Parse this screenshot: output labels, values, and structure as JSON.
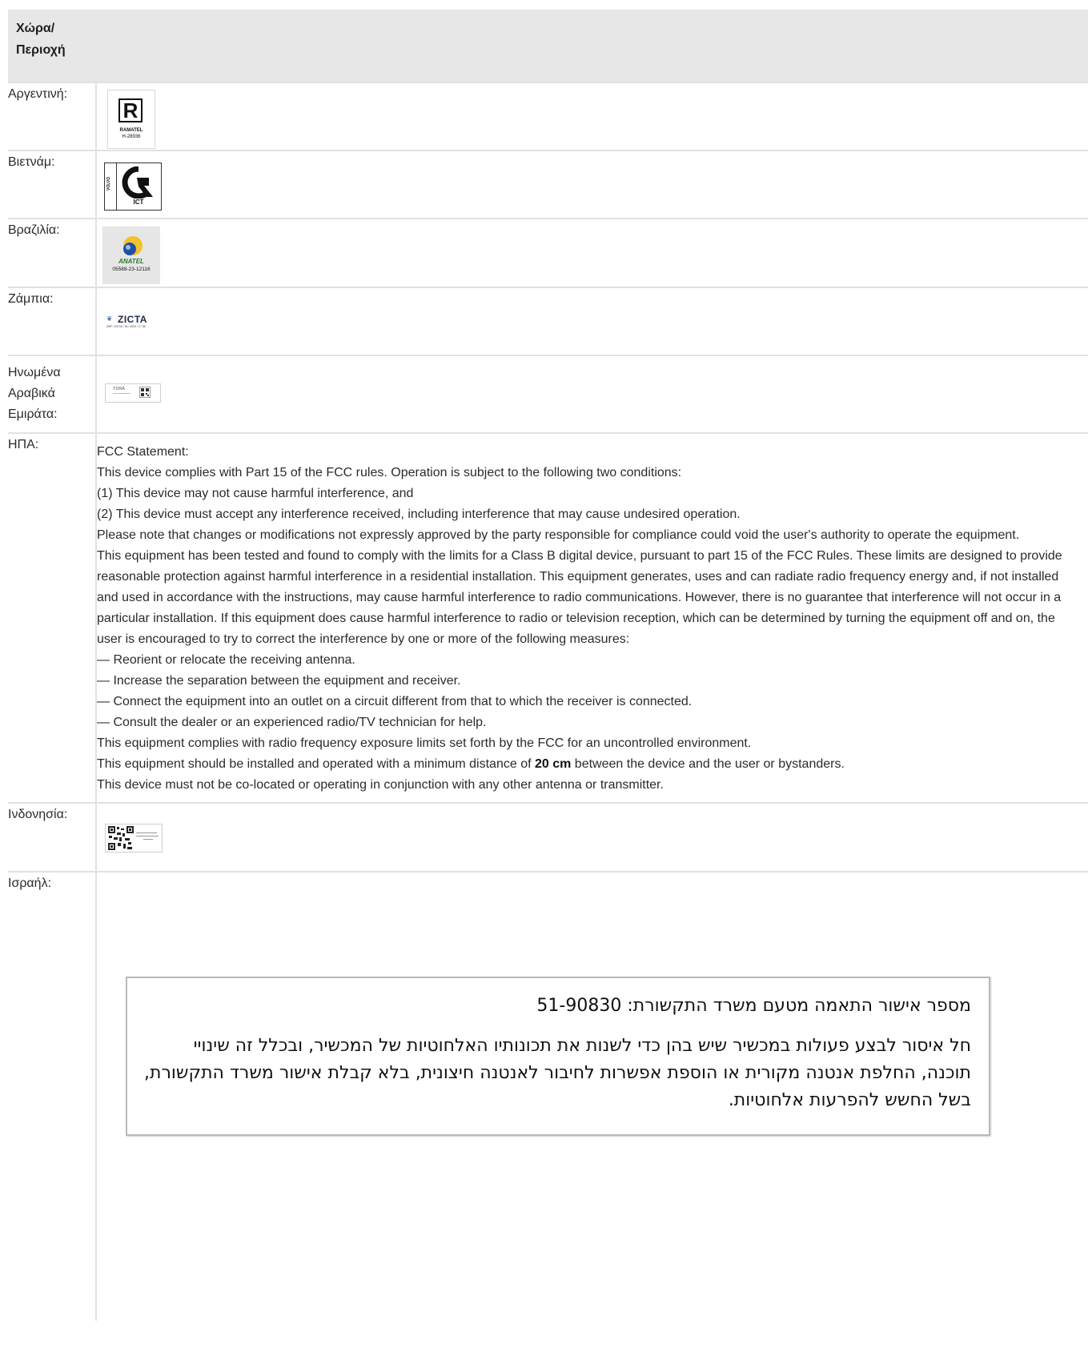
{
  "header": {
    "country_col": "Χώρα/\nΠεριοχή",
    "content_col": ""
  },
  "rows": {
    "argentina": {
      "country": "Αργεντινή:",
      "logo_icon": "ramatel-logo",
      "logo_text": [
        "RAMATEL",
        "H-28936"
      ]
    },
    "vietnam": {
      "country": "Βιετνάμ:",
      "logo_icon": "ict-logo",
      "logo_text": [
        "VOLVO",
        "ICT"
      ]
    },
    "brazil": {
      "country": "Βραζιλία:",
      "logo_icon": "anatel-logo",
      "logo_text": [
        "ANATEL",
        "05588-23-12116"
      ]
    },
    "zambia": {
      "country": "Ζάμπια:",
      "logo_icon": "zicta-logo",
      "logo_text": [
        "ZICTA",
        "ZNF / ZICTA / TA / 2023 / 2 / 36"
      ]
    },
    "uae": {
      "country": "Ηνωμένα\nΑραβικά\nΕμιράτα:",
      "logo_icon": "tdra-logo",
      "logo_text": [
        "TDRA"
      ]
    },
    "usa": {
      "country": "ΗΠΑ:",
      "fcc_lines": [
        "FCC Statement:",
        "This device complies with Part 15 of the FCC rules. Operation is subject to the following two conditions:",
        "(1) This device may not cause harmful interference, and",
        "(2) This device must accept any interference received, including interference that may cause undesired operation.",
        "Please note that changes or modifications not expressly approved by the party responsible for compliance could void the user's authority to operate the equipment.",
        "This equipment has been tested and found to comply with the limits for a Class B digital device, pursuant to part 15 of the FCC Rules. These limits are designed to provide reasonable protection against harmful interference in a residential installation. This equipment generates, uses and can radiate radio frequency energy and, if not installed and used in accordance with the instructions, may cause harmful interference to radio communications. However, there is no guarantee that interference will not occur in a particular installation. If this equipment does cause harmful interference to radio or television reception, which can be determined by turning the equipment off and on, the user is encouraged to try to correct the interference by one or more of the following measures:",
        "— Reorient or relocate the receiving antenna.",
        "— Increase the separation between the equipment and receiver.",
        "— Connect the equipment into an outlet on a circuit different from that to which the receiver is connected.",
        "— Consult the dealer or an experienced radio/TV technician for help.",
        "This equipment complies with radio frequency exposure limits set forth by the FCC for an uncontrolled environment."
      ],
      "distance_prefix": "This equipment should be installed and operated with a minimum distance of ",
      "distance_value": "20 cm",
      "distance_suffix": " between the device and the user or bystanders.",
      "last_line": "This device must not be co-located or operating in conjunction with any other antenna or transmitter."
    },
    "indonesia": {
      "country": "Ινδονησία:",
      "logo_icon": "kominfo-qr-logo"
    },
    "israel": {
      "country": "Ισραήλ:",
      "hebrew_title": "מספר אישור התאמה מטעם משרד התקשורת: 51-90830",
      "hebrew_body": "חל איסור לבצע פעולות במכשיר שיש בהן כדי לשנות את תכונותיו האלחוטיות של המכשיר, ובכלל זה שינויי תוכנה, החלפת אנטנה מקורית או הוספת אפשרות לחיבור לאנטנה חיצונית, בלא קבלת אישור משרד התקשורת, בשל החשש להפרעות אלחוטיות."
    }
  }
}
